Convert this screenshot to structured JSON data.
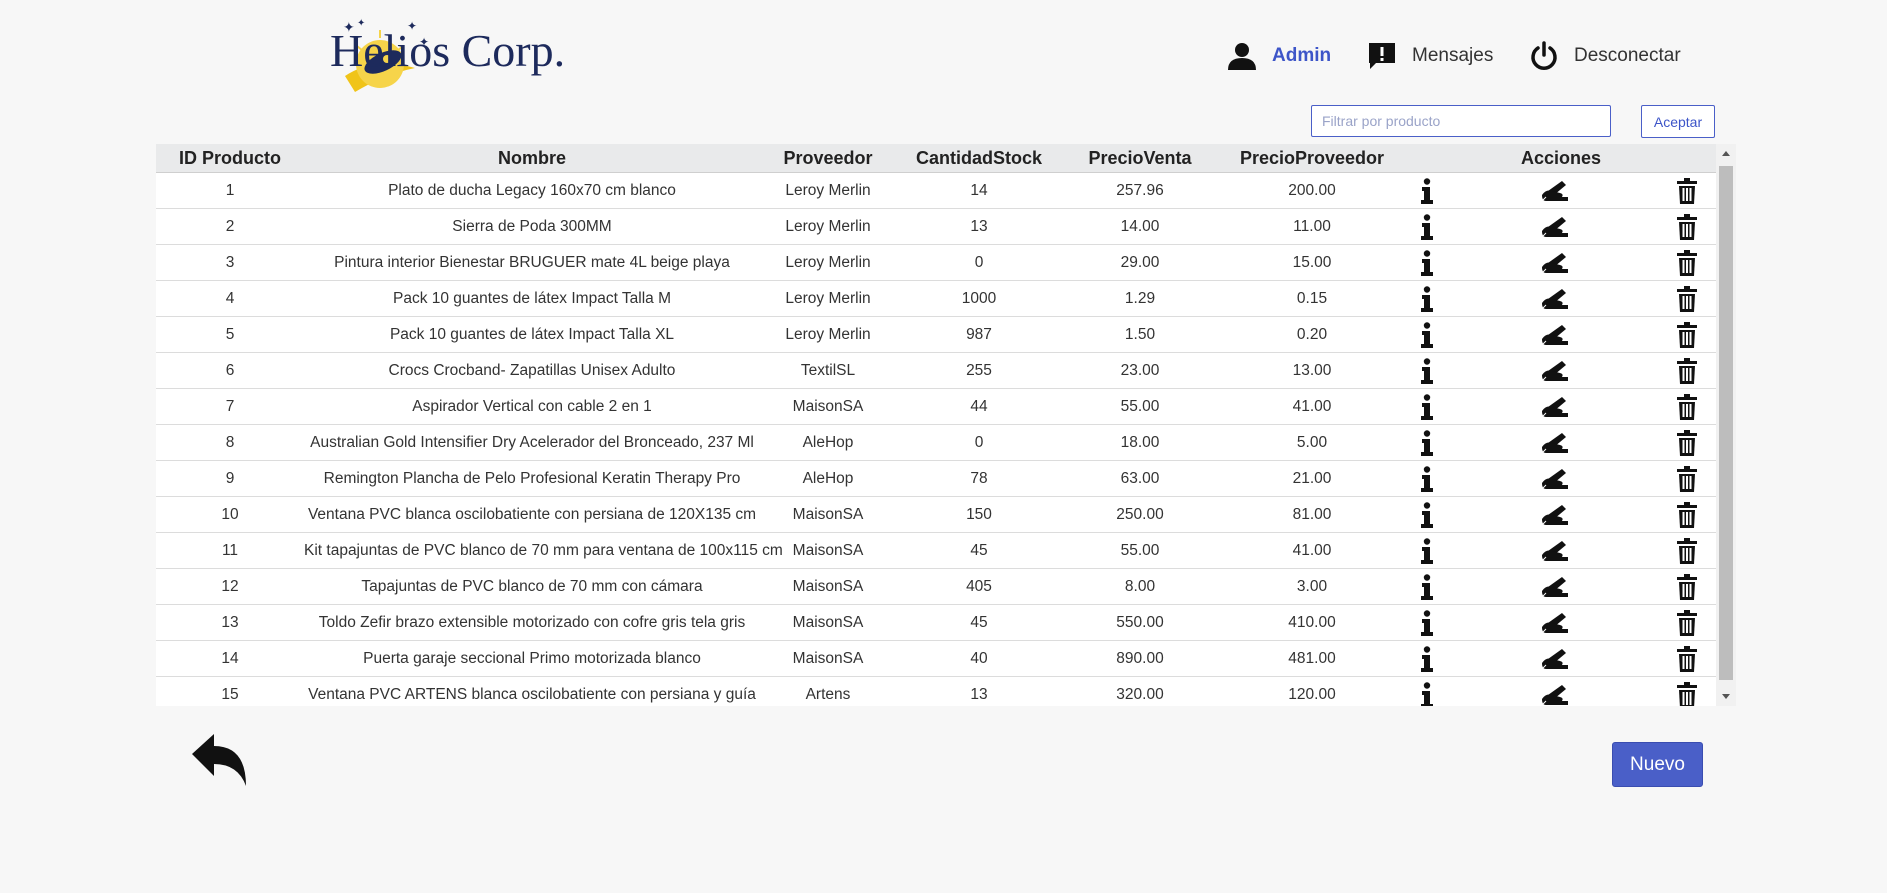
{
  "brand": {
    "name": "Helios Corp."
  },
  "header": {
    "user_label": "Admin",
    "messages_label": "Mensajes",
    "logout_label": "Desconectar"
  },
  "filter": {
    "placeholder": "Filtrar por producto",
    "accept_label": "Aceptar"
  },
  "table": {
    "columns": [
      "ID Producto",
      "Nombre",
      "Proveedor",
      "CantidadStock",
      "PrecioVenta",
      "PrecioProveedor",
      "Acciones"
    ],
    "rows": [
      [
        "1",
        "Plato de ducha Legacy 160x70 cm blanco",
        "Leroy Merlin",
        "14",
        "257.96",
        "200.00"
      ],
      [
        "2",
        "Sierra de Poda 300MM",
        "Leroy Merlin",
        "13",
        "14.00",
        "11.00"
      ],
      [
        "3",
        "Pintura interior Bienestar BRUGUER mate 4L beige playa",
        "Leroy Merlin",
        "0",
        "29.00",
        "15.00"
      ],
      [
        "4",
        "Pack 10 guantes de látex Impact Talla M",
        "Leroy Merlin",
        "1000",
        "1.29",
        "0.15"
      ],
      [
        "5",
        "Pack 10 guantes de látex Impact Talla XL",
        "Leroy Merlin",
        "987",
        "1.50",
        "0.20"
      ],
      [
        "6",
        "Crocs Crocband- Zapatillas Unisex Adulto",
        "TextilSL",
        "255",
        "23.00",
        "13.00"
      ],
      [
        "7",
        "Aspirador Vertical con cable 2 en 1",
        "MaisonSA",
        "44",
        "55.00",
        "41.00"
      ],
      [
        "8",
        "Australian Gold Intensifier Dry Acelerador del Bronceado, 237 Ml",
        "AleHop",
        "0",
        "18.00",
        "5.00"
      ],
      [
        "9",
        "Remington Plancha de Pelo Profesional Keratin Therapy Pro",
        "AleHop",
        "78",
        "63.00",
        "21.00"
      ],
      [
        "10",
        "Ventana PVC blanca oscilobatiente con persiana de 120X135 cm",
        "MaisonSA",
        "150",
        "250.00",
        "81.00"
      ],
      [
        "11",
        "Kit tapajuntas de PVC blanco de 70 mm para ventana de 100x115 cm",
        "MaisonSA",
        "45",
        "55.00",
        "41.00"
      ],
      [
        "12",
        "Tapajuntas de PVC blanco de 70 mm con cámara",
        "MaisonSA",
        "405",
        "8.00",
        "3.00"
      ],
      [
        "13",
        "Toldo Zefir brazo extensible motorizado con cofre gris tela gris",
        "MaisonSA",
        "45",
        "550.00",
        "410.00"
      ],
      [
        "14",
        "Puerta garaje seccional Primo motorizada blanco",
        "MaisonSA",
        "40",
        "890.00",
        "481.00"
      ],
      [
        "15",
        "Ventana PVC ARTENS blanca oscilobatiente con persiana y guía",
        "Artens",
        "13",
        "320.00",
        "120.00"
      ]
    ]
  },
  "footer": {
    "new_label": "Nuevo"
  },
  "icons": {
    "logo": "rocket-sun-logo",
    "user": "user-icon",
    "messages": "message-alert-icon",
    "logout": "power-icon",
    "info": "info-icon",
    "edit": "edit-hand-icon",
    "delete": "trash-icon",
    "back": "reply-arrow-icon"
  },
  "colors": {
    "accent": "#4a5fc8",
    "header_bg": "#e9eaeb",
    "page_bg": "#f7f7f7"
  }
}
